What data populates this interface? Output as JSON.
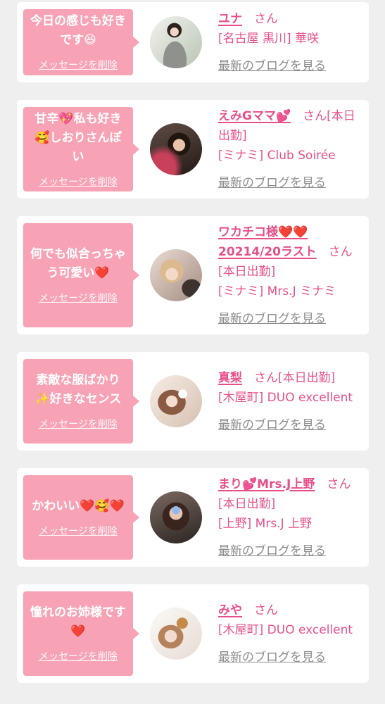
{
  "colors": {
    "page-bg": "#efefef",
    "card-bg": "#ffffff",
    "bubble": "#f7a3b5",
    "accent": "#e6508a",
    "muted": "#8c8c8c"
  },
  "labels": {
    "delete_message": "メッセージを削除",
    "honorific": "さん",
    "latest_blog": "最新のブログを見る"
  },
  "cards": [
    {
      "message": "今日の感じも好きです😆",
      "name": "ユナ",
      "shop": "[名古屋 黒川] 華咲"
    },
    {
      "message": "甘辛💖私も好き🥰しおりさんぽい",
      "name": "えみGママ💕",
      "status": "[本日出勤]",
      "shop": "[ミナミ] Club Soirée"
    },
    {
      "message": "何でも似合っちゃう可愛い❤️",
      "name": "ワカチコ様❤️❤️20214/20ラスト",
      "status": "[本日出勤]",
      "shop": "[ミナミ] Mrs.J ミナミ"
    },
    {
      "message": "素敵な服ばかり✨好きなセンス",
      "name": "真梨",
      "status": "[本日出勤]",
      "shop": "[木屋町] DUO excellent"
    },
    {
      "message": "かわいい❤️🥰❤️",
      "name": "まり💕Mrs.J上野",
      "status": "[本日出勤]",
      "shop": "[上野] Mrs.J 上野"
    },
    {
      "message": "憧れのお姉様です❤️",
      "name": "みや",
      "shop": "[木屋町] DUO excellent"
    }
  ]
}
